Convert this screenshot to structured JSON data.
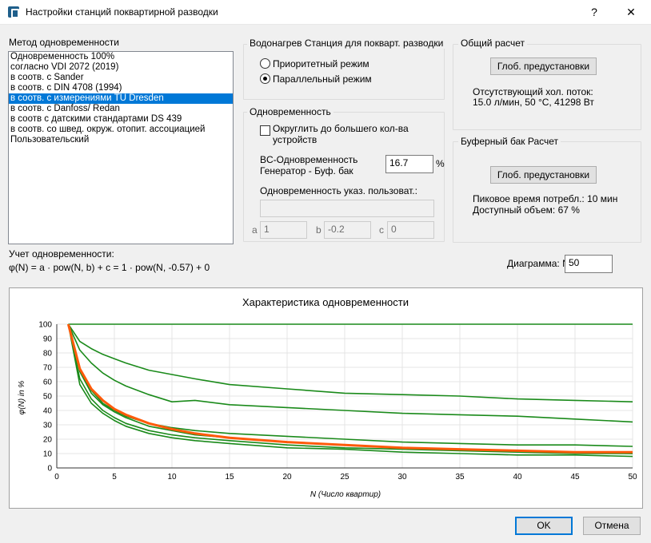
{
  "window": {
    "title": "Настройки станций поквартирной разводки",
    "help": "?",
    "close": "✕"
  },
  "method": {
    "label": "Метод одновременности",
    "items": [
      "Одновременность 100%",
      "согласно VDI 2072 (2019)",
      "в соотв. с Sander",
      "в соотв. с DIN 4708 (1994)",
      "в соотв. с измерениями TU Dresden",
      "в соотв. с Danfoss/ Redan",
      "в соотв с датскими стандартами DS 439",
      "в соотв. со швед. окруж. отопит. ассоциацией",
      "Пользовательский"
    ],
    "selected_index": 4
  },
  "heating": {
    "title": "Водонагрев Станция для покварт. разводки",
    "options": [
      "Приоритетный режим",
      "Параллельный режим"
    ],
    "selected_index": 1
  },
  "simultaneity": {
    "title": "Одновременность",
    "round_label": "Округлить до большего кол-ва устройств",
    "round_checked": false,
    "bc_label_line1": "BC-Одновременность",
    "bc_label_line2": "Генератор - Буф. бак",
    "bc_value": "16.7",
    "bc_unit": "%",
    "user_label": "Одновременность указ. пользоват.:",
    "user_value": "",
    "a_label": "a",
    "a_value": "1",
    "b_label": "b",
    "b_value": "-0.2",
    "c_label": "c",
    "c_value": "0"
  },
  "general": {
    "title": "Общий расчет",
    "button": "Глоб. предустановки",
    "line1": "Отсутствующий хол. поток:",
    "line2": "15.0 л/мин, 50 °С, 41298 Вт"
  },
  "buffer": {
    "title": "Буферный бак Расчет",
    "button": "Глоб. предустановки",
    "line1": "Пиковое время потребл.: 10 мин",
    "line2": "Доступный объем: 67 %"
  },
  "formula": {
    "label": "Учет одновременности:",
    "text": "φ(N) = a · pow(N, b) + c = 1 · pow(N, -0.57) + 0"
  },
  "diagram": {
    "label": "Диаграмма: N",
    "value": "50"
  },
  "footer": {
    "ok": "OK",
    "cancel": "Отмена"
  },
  "chart_data": {
    "type": "line",
    "title": "Характеристика одновременности",
    "xlabel": "N (Число квартир)",
    "ylabel": "φ(N) in %",
    "xlim": [
      0,
      50
    ],
    "ylim": [
      0,
      100
    ],
    "xticks": [
      0,
      5,
      10,
      15,
      20,
      25,
      30,
      35,
      40,
      45,
      50
    ],
    "yticks": [
      0,
      10,
      20,
      30,
      40,
      50,
      60,
      70,
      80,
      90,
      100
    ],
    "grid": true,
    "colors": {
      "curves": "#1a8a1a",
      "selected": "#ff5a0a"
    },
    "x": [
      1,
      2,
      3,
      4,
      5,
      6,
      8,
      10,
      12,
      15,
      20,
      25,
      30,
      35,
      40,
      45,
      50
    ],
    "series": [
      {
        "values": [
          100,
          100,
          100,
          100,
          100,
          100,
          100,
          100,
          100,
          100,
          100,
          100,
          100,
          100,
          100,
          100,
          100
        ]
      },
      {
        "values": [
          100,
          88,
          83,
          79,
          76,
          73,
          68,
          65,
          62,
          58,
          55,
          52,
          51,
          50,
          48,
          47,
          46
        ]
      },
      {
        "values": [
          100,
          82,
          73,
          66,
          61,
          57,
          51,
          46,
          47,
          44,
          42,
          40,
          38,
          37,
          36,
          34,
          32
        ]
      },
      {
        "values": [
          100,
          68,
          54,
          45,
          40,
          36,
          31,
          28,
          26,
          24,
          22,
          20,
          18,
          17,
          16,
          16,
          15
        ]
      },
      {
        "values": [
          100,
          69,
          55,
          47,
          41,
          37,
          31,
          27,
          24,
          21,
          18,
          16,
          14,
          13,
          12,
          11,
          11
        ],
        "selected": true
      },
      {
        "values": [
          100,
          67,
          52,
          44,
          39,
          35,
          29,
          26,
          23,
          21,
          18,
          16,
          14,
          13,
          12,
          11,
          10
        ]
      },
      {
        "values": [
          100,
          62,
          48,
          40,
          35,
          31,
          26,
          23,
          21,
          19,
          16,
          14,
          13,
          12,
          11,
          10,
          10
        ]
      },
      {
        "values": [
          100,
          58,
          45,
          38,
          33,
          29,
          24,
          21,
          19,
          17,
          14,
          13,
          11,
          10,
          9,
          9,
          8
        ]
      }
    ]
  }
}
